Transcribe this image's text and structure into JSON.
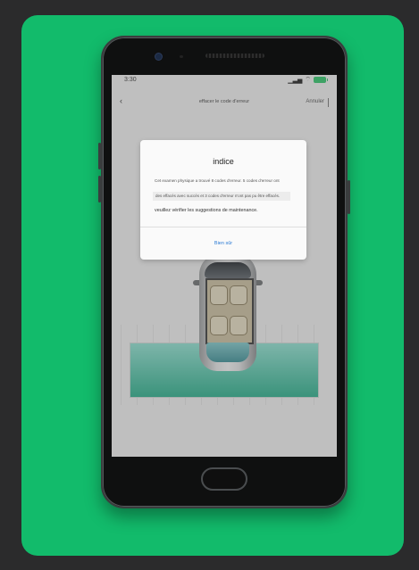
{
  "device": {
    "status_bar": {
      "time": "3:30",
      "signal_icon": "signal-icon",
      "wifi_icon": "wifi-icon",
      "battery_icon": "battery-icon"
    },
    "app_bar": {
      "back_icon": "back-arrow-icon",
      "title": "effacer le code d'erreur",
      "cancel_label": "Annuler"
    },
    "dialog": {
      "title": "indice",
      "line1": "Cet examen physique a trouvé 8 codes d'erreur. 5 codes d'erreur ont",
      "line2": "des effacés avec succès et 3 codes d'erreur n'ont pas pu être effacés.",
      "line3": "veuillez vérifier les suggestions de maintenance.",
      "ok_label": "Bien sûr"
    }
  },
  "colors": {
    "background_card": "#12bb6b",
    "dialog_link": "#2a7ad4",
    "floor_teal": "#2cae8b"
  }
}
